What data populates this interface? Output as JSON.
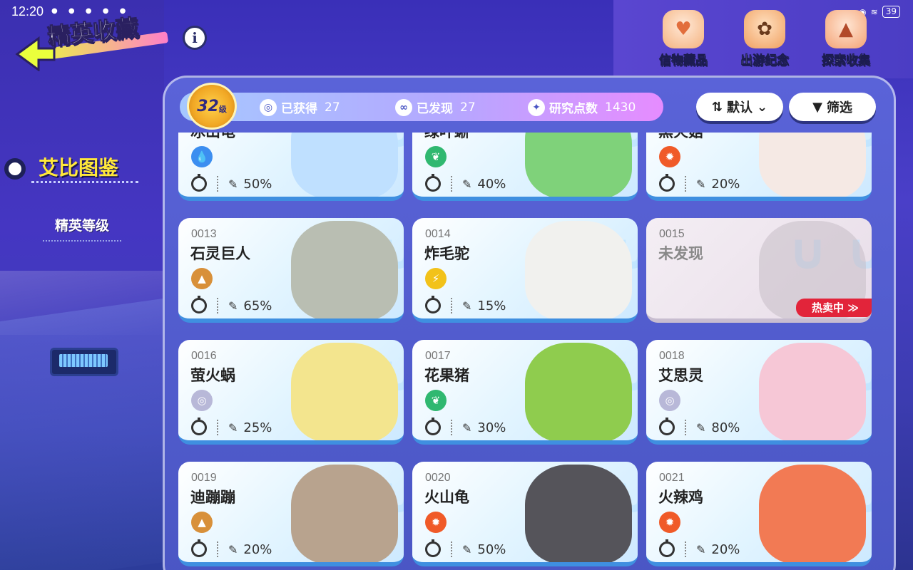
{
  "status_bar": {
    "time": "12:20",
    "battery": "39"
  },
  "header": {
    "title": "精英收藏"
  },
  "top_nav": [
    {
      "label": "信物藏品",
      "icon": "heart-badge-icon"
    },
    {
      "label": "出游纪念",
      "icon": "paw-phone-icon"
    },
    {
      "label": "探索收集",
      "icon": "mountain-icon"
    }
  ],
  "sidebar": {
    "active": "艾比图鉴",
    "items": [
      {
        "label": "精英等级"
      }
    ]
  },
  "stats": {
    "level": "32",
    "level_suffix": "级",
    "obtained_label": "已获得",
    "obtained": "27",
    "discovered_label": "已发现",
    "discovered": "27",
    "research_label": "研究点数",
    "research": "1430"
  },
  "toolbar": {
    "sort_label": "默认",
    "filter_label": "筛选"
  },
  "colors": {
    "water": "#3c8ef0",
    "grass": "#30b870",
    "fire": "#f05a28",
    "earth": "#d8903a",
    "electric": "#f2c21a",
    "neutral": "#b8b8d8"
  },
  "cards": [
    {
      "id": "",
      "name": "冰山龟",
      "type": "water",
      "stat": "50%",
      "art": "#bfe0ff"
    },
    {
      "id": "",
      "name": "绿叶蜥",
      "type": "grass",
      "stat": "40%",
      "art": "#7fd27a"
    },
    {
      "id": "",
      "name": "黑火菇",
      "type": "fire",
      "stat": "20%",
      "art": "#f5e9e4"
    },
    {
      "id": "0013",
      "name": "石灵巨人",
      "type": "earth",
      "stat": "65%",
      "art": "#b9beb2"
    },
    {
      "id": "0014",
      "name": "炸毛驼",
      "type": "electric",
      "stat": "15%",
      "art": "#f1f1ee"
    },
    {
      "id": "0015",
      "name": "未发现",
      "type": "",
      "stat": "",
      "art": "#c7bdc7",
      "hot": "热卖中 ≫"
    },
    {
      "id": "0016",
      "name": "萤火蜗",
      "type": "neutral",
      "stat": "25%",
      "art": "#f3e58e"
    },
    {
      "id": "0017",
      "name": "花果猪",
      "type": "grass",
      "stat": "30%",
      "art": "#8fcc4e"
    },
    {
      "id": "0018",
      "name": "艾思灵",
      "type": "neutral",
      "stat": "80%",
      "art": "#f6c7d6"
    },
    {
      "id": "0019",
      "name": "迪蹦蹦",
      "type": "earth",
      "stat": "20%",
      "art": "#b8a38e"
    },
    {
      "id": "0020",
      "name": "火山龟",
      "type": "fire",
      "stat": "50%",
      "art": "#55545a"
    },
    {
      "id": "0021",
      "name": "火辣鸡",
      "type": "fire",
      "stat": "20%",
      "art": "#f27a54"
    }
  ]
}
